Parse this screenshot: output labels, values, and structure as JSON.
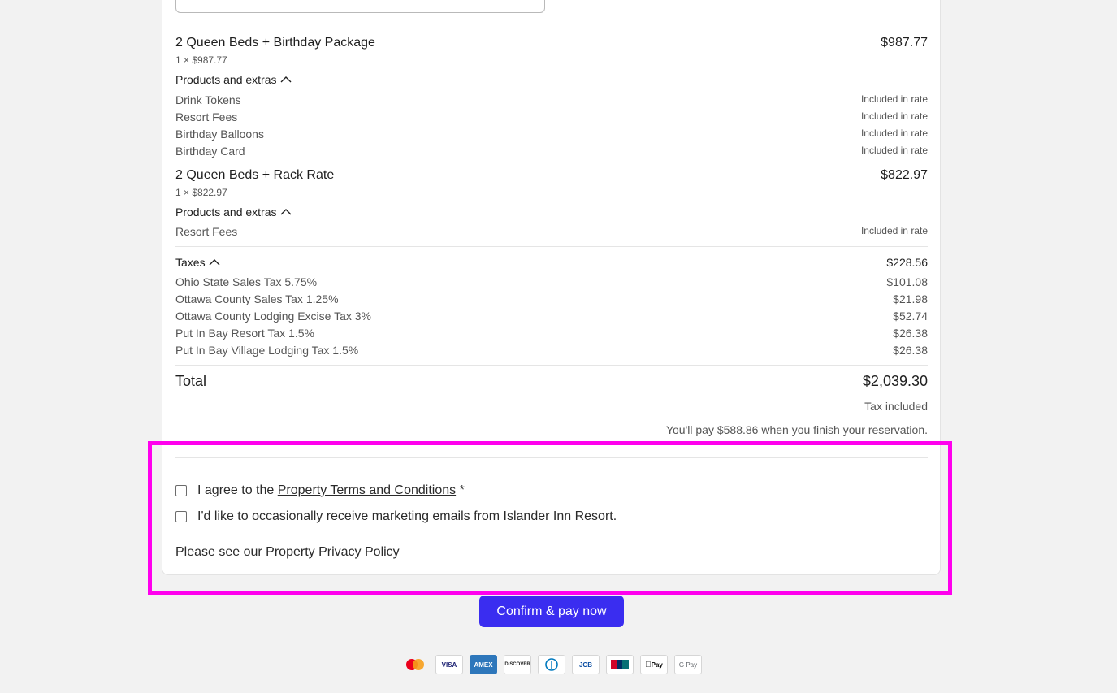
{
  "rooms": [
    {
      "title": "2 Queen Beds + Birthday Package",
      "qty_line": "1 × $987.77",
      "price": "$987.77",
      "extras_label": "Products and extras",
      "extras": [
        {
          "name": "Drink Tokens",
          "value": "Included in rate"
        },
        {
          "name": "Resort Fees",
          "value": "Included in rate"
        },
        {
          "name": "Birthday Balloons",
          "value": "Included in rate"
        },
        {
          "name": "Birthday Card",
          "value": "Included in rate"
        }
      ]
    },
    {
      "title": "2 Queen Beds + Rack Rate",
      "qty_line": "1 × $822.97",
      "price": "$822.97",
      "extras_label": "Products and extras",
      "extras": [
        {
          "name": "Resort Fees",
          "value": "Included in rate"
        }
      ]
    }
  ],
  "taxes": {
    "label": "Taxes",
    "total": "$228.56",
    "items": [
      {
        "name": "Ohio State Sales Tax 5.75%",
        "value": "$101.08"
      },
      {
        "name": "Ottawa County Sales Tax 1.25%",
        "value": "$21.98"
      },
      {
        "name": "Ottawa County Lodging Excise Tax 3%",
        "value": "$52.74"
      },
      {
        "name": "Put In Bay Resort Tax 1.5%",
        "value": "$26.38"
      },
      {
        "name": "Put In Bay Village Lodging Tax 1.5%",
        "value": "$26.38"
      }
    ]
  },
  "total": {
    "label": "Total",
    "value": "$2,039.30",
    "tax_note": "Tax included",
    "pay_later_note": "You'll pay $588.86 when you finish your reservation."
  },
  "consent": {
    "terms_prefix": "I agree to the",
    "terms_link": "Property Terms and Conditions",
    "terms_required": "*",
    "marketing_label": "I'd like to occasionally receive marketing emails from Islander Inn Resort.",
    "privacy_text": "Please see our Property Privacy Policy"
  },
  "confirm_button": "Confirm & pay now",
  "payment_icons": [
    {
      "name": "mastercard-icon",
      "label": ""
    },
    {
      "name": "visa-icon",
      "label": "VISA"
    },
    {
      "name": "amex-icon",
      "label": "AMEX"
    },
    {
      "name": "discover-icon",
      "label": "DISCOVER"
    },
    {
      "name": "diners-club-icon",
      "label": ""
    },
    {
      "name": "jcb-icon",
      "label": "JCB"
    },
    {
      "name": "unionpay-icon",
      "label": ""
    },
    {
      "name": "apple-pay-icon",
      "label": "Pay"
    },
    {
      "name": "google-pay-icon",
      "label": "G Pay"
    }
  ],
  "colors": {
    "accent": "#3a2df0",
    "highlight": "#ff00ee"
  }
}
